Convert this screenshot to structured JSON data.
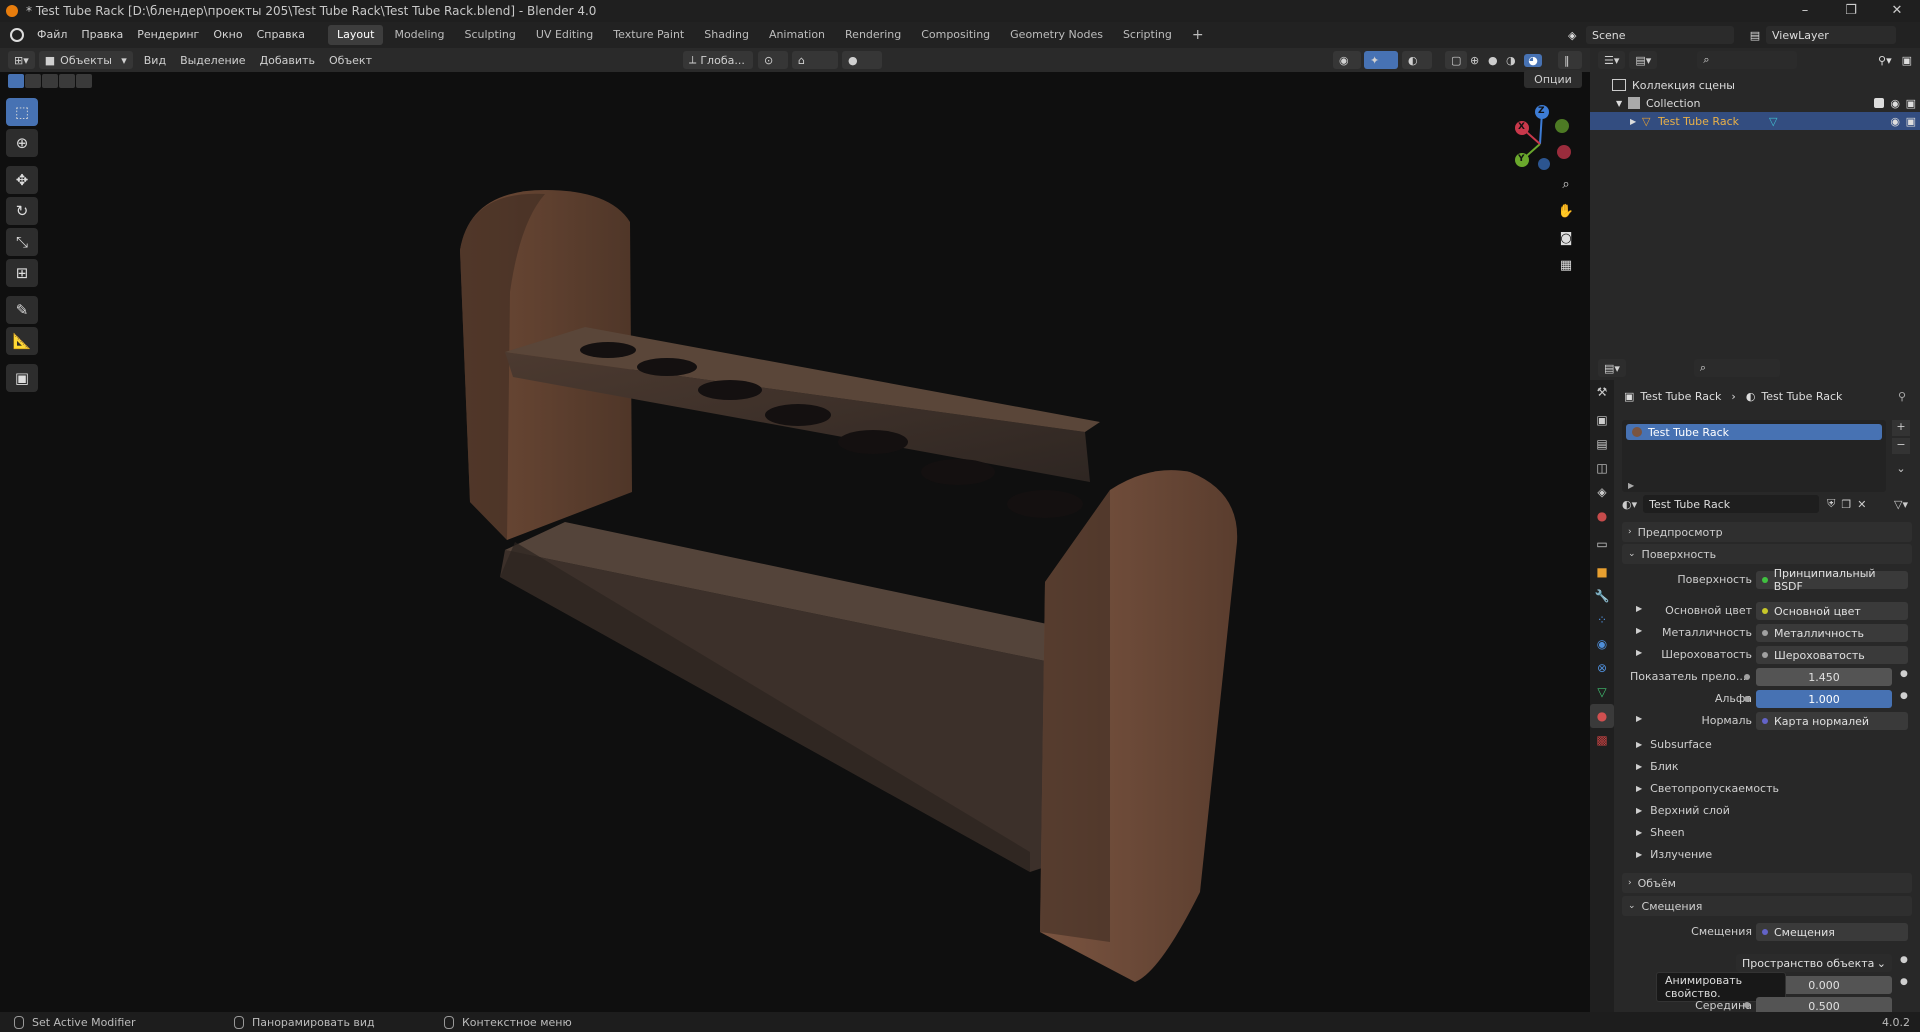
{
  "window": {
    "title": "* Test Tube Rack [D:\\блендер\\проекты 205\\Test Tube Rack\\Test Tube Rack.blend] - Blender 4.0",
    "minimize": "–",
    "restore": "❐",
    "close": "✕"
  },
  "menu": {
    "items": [
      "Файл",
      "Правка",
      "Рендеринг",
      "Окно",
      "Справка"
    ]
  },
  "workspaces": {
    "tabs": [
      "Layout",
      "Modeling",
      "Sculpting",
      "UV Editing",
      "Texture Paint",
      "Shading",
      "Animation",
      "Rendering",
      "Compositing",
      "Geometry Nodes",
      "Scripting"
    ],
    "active": "Layout",
    "add": "+"
  },
  "scene": {
    "name": "Scene",
    "view_layer": "ViewLayer"
  },
  "viewport_header": {
    "mode": "Объекты",
    "menus": [
      "Вид",
      "Выделение",
      "Добавить",
      "Объект"
    ],
    "transform_orientation": "Глоба...",
    "options": "Опции"
  },
  "gizmo": {
    "x": "X",
    "y": "Y",
    "z": "Z"
  },
  "outliner": {
    "root": "Коллекция сцены",
    "collection": "Collection",
    "object": "Test Tube Rack"
  },
  "properties": {
    "breadcrumb": [
      "Test Tube Rack",
      "Test Tube Rack"
    ],
    "material_slot": "Test Tube Rack",
    "material_name": "Test Tube Rack",
    "panels": {
      "preview": "Предпросмотр",
      "surface": "Поверхность",
      "volume": "Объём",
      "displacement": "Смещения"
    },
    "surface": {
      "label": "Поверхность",
      "value": "Принципиальный BSDF"
    },
    "rows": [
      {
        "label": "Основной цвет",
        "value": "Основной цвет",
        "color": "#c7c729"
      },
      {
        "label": "Металличность",
        "value": "Металличность",
        "color": "#a1a1a1"
      },
      {
        "label": "Шероховатость",
        "value": "Шероховатость",
        "color": "#a1a1a1"
      }
    ],
    "ior": {
      "label": "Показатель прело...",
      "value": "1.450"
    },
    "alpha": {
      "label": "Альфа",
      "value": "1.000"
    },
    "normal": {
      "label": "Нормаль",
      "value": "Карта нормалей",
      "color": "#6363c7"
    },
    "subpanels": [
      "Subsurface",
      "Блик",
      "Светопропускаемость",
      "Верхний слой",
      "Sheen",
      "Излучение"
    ],
    "displacement": {
      "label": "Смещения",
      "value": "Смещения",
      "space": "Пространство объекта",
      "tooltip": "Анимировать свойство.",
      "height_value": "0.000",
      "midlevel_label": "Середина",
      "midlevel_value": "0.500"
    }
  },
  "statusbar": {
    "left": "Set Active Modifier",
    "middle": "Панорамировать вид",
    "right": "Контекстное меню",
    "version": "4.0.2"
  }
}
